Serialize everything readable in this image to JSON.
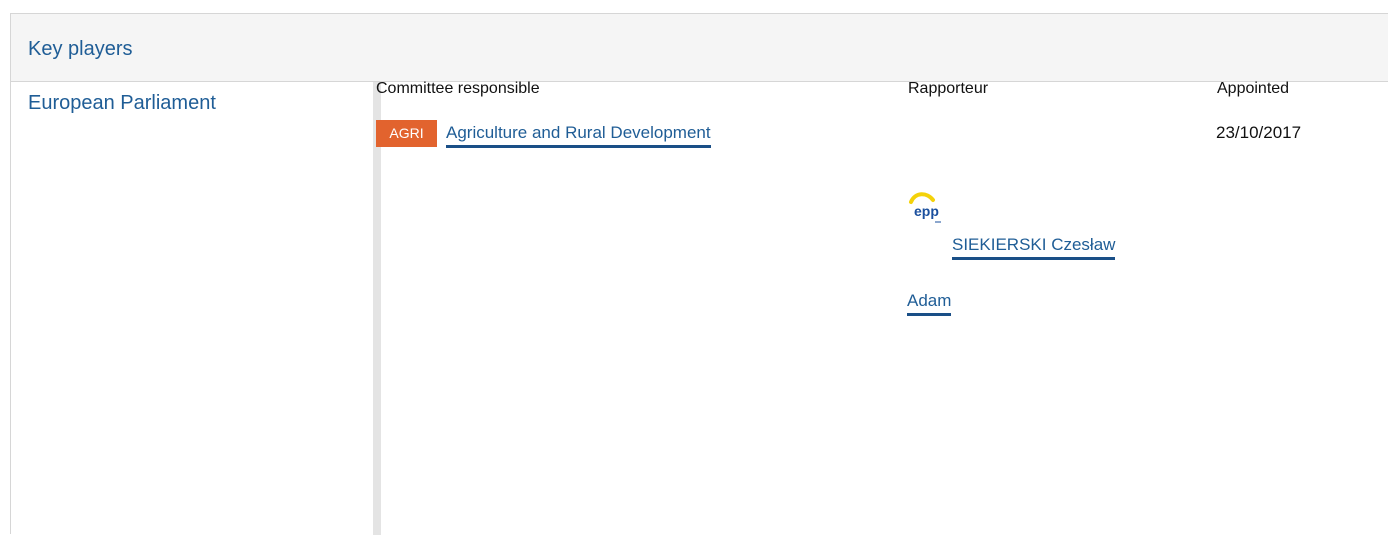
{
  "section": {
    "title": "Key players"
  },
  "institution": {
    "name": "European Parliament"
  },
  "columns": {
    "committee": "Committee responsible",
    "rapporteur": "Rapporteur",
    "appointed": "Appointed"
  },
  "committee": {
    "badge": "AGRI",
    "badge_color": "#e2632e",
    "name": "Agriculture and Rural Development",
    "appointed_date": "23/10/2017"
  },
  "rapporteur": {
    "group_logo": "epp-group-logo",
    "logo_text": "epp",
    "name_line1": "SIEKIERSKI Czesław",
    "name_line2": "Adam"
  },
  "colors": {
    "link": "#1f5d96",
    "header_bg": "#f5f5f5",
    "divider": "#e4e4e4"
  }
}
